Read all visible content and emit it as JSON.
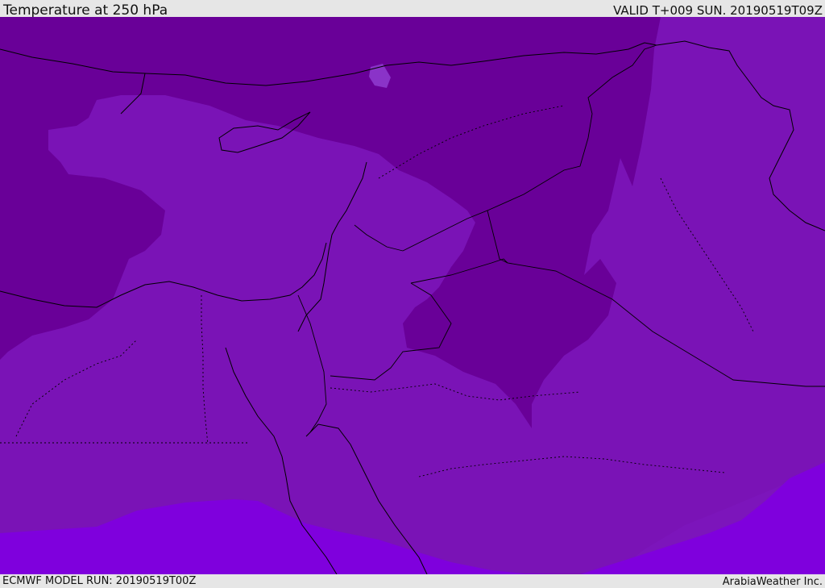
{
  "header": {
    "title": "Temperature at 250 hPa",
    "valid_time": "VALID T+009 SUN. 20190519T09Z"
  },
  "footer": {
    "model_run": "ECMWF MODEL RUN: 20190519T00Z",
    "credit": "ArabiaWeather Inc."
  },
  "map": {
    "colors": {
      "coldest": "#690098",
      "cold": "#7a13b6",
      "mild": "#7c15bb",
      "warm": "#7f00dd",
      "pale": "#8a33c8"
    }
  }
}
